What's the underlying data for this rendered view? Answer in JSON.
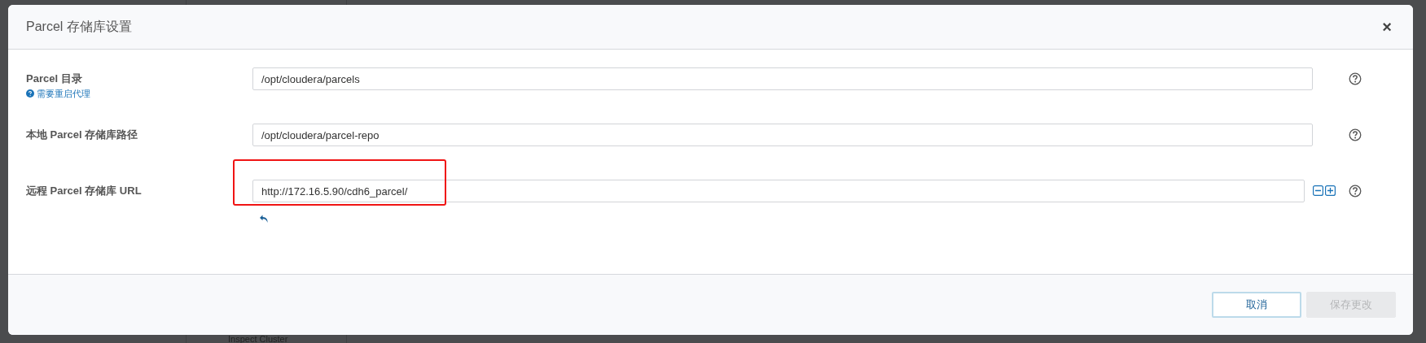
{
  "dialog": {
    "title": "Parcel 存储库设置",
    "close": "×"
  },
  "fields": [
    {
      "label": "Parcel 目录",
      "hint": "需要重启代理",
      "value": "/opt/cloudera/parcels",
      "kind": "single"
    },
    {
      "label": "本地 Parcel 存储库路径",
      "value": "/opt/cloudera/parcel-repo",
      "kind": "single"
    },
    {
      "label": "远程 Parcel 存储库 URL",
      "value": "http://172.16.5.90/cdh6_parcel/",
      "kind": "list",
      "highlighted": true
    }
  ],
  "buttons": [
    {
      "label": "取消",
      "disabled": false
    },
    {
      "label": "保存更改",
      "disabled": true
    }
  ],
  "background": {
    "item": "Inspect Cluster"
  }
}
